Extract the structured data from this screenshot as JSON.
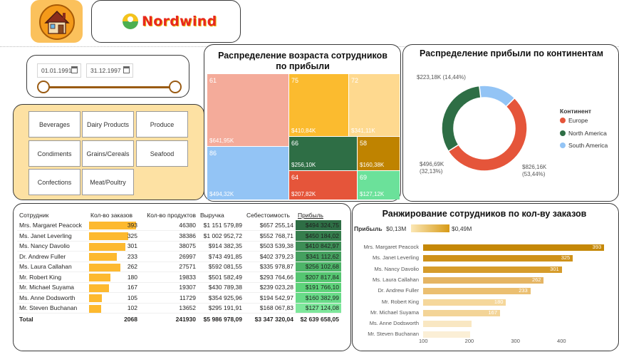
{
  "header": {
    "logo_text": "Nordwind"
  },
  "date_slicer": {
    "start": "01.01.1991",
    "end": "31.12.1997"
  },
  "categories": [
    "Beverages",
    "Dairy Products",
    "Produce",
    "Condiments",
    "Grains/Cereals",
    "Seafood",
    "Confections",
    "Meat/Poultry"
  ],
  "treemap": {
    "title": "Распределение возраста сотрудников по прибыли",
    "tiles": [
      {
        "age": "61",
        "profit": "$641,95K",
        "color": "#f4ab9a"
      },
      {
        "age": "75",
        "profit": "$410,84K",
        "color": "#fbbb2f"
      },
      {
        "age": "72",
        "profit": "$341,11K",
        "color": "#fed98f"
      },
      {
        "age": "86",
        "profit": "$494,32K",
        "color": "#93c4f5"
      },
      {
        "age": "66",
        "profit": "$256,10K",
        "color": "#2e6e45"
      },
      {
        "age": "58",
        "profit": "$160,38K",
        "color": "#bf8300"
      },
      {
        "age": "64",
        "profit": "$207,82K",
        "color": "#e5553a"
      },
      {
        "age": "69",
        "profit": "$127,12K",
        "color": "#6be19a"
      }
    ]
  },
  "donut": {
    "title": "Распределение прибыли по континентам",
    "legend_title": "Континент",
    "slices": [
      {
        "name": "Europe",
        "value_label": "$826,16K",
        "pct_label": "(53,44%)",
        "share": 0.5344,
        "color": "#e5553a"
      },
      {
        "name": "North America",
        "value_label": "$496,69K",
        "pct_label": "(32,13%)",
        "share": 0.3213,
        "color": "#2e6e45"
      },
      {
        "name": "South America",
        "value_label": "$223,18K",
        "pct_label": "(14,44%)",
        "share": 0.1444,
        "color": "#93c4f5"
      }
    ]
  },
  "table": {
    "headers": [
      "Сотрудник",
      "Кол-во заказов",
      "Кол-во продуктов",
      "Выручка",
      "Себестоимость",
      "Прибыль"
    ],
    "rows": [
      {
        "name": "Mrs. Margaret Peacock",
        "orders": 393,
        "products": "46380",
        "revenue": "$1 151 579,89",
        "cost": "$657 255,14",
        "profit": "$494 324,75",
        "green": "#2e6e45"
      },
      {
        "name": "Ms. Janet Leverling",
        "orders": 325,
        "products": "38386",
        "revenue": "$1 002 952,72",
        "cost": "$552 768,71",
        "profit": "$450 184,02",
        "green": "#357e4d"
      },
      {
        "name": "Ms. Nancy Davolio",
        "orders": 301,
        "products": "38075",
        "revenue": "$914 382,35",
        "cost": "$503 539,38",
        "profit": "$410 842,97",
        "green": "#3d8e56"
      },
      {
        "name": "Dr. Andrew Fuller",
        "orders": 233,
        "products": "26997",
        "revenue": "$743 491,85",
        "cost": "$402 379,23",
        "profit": "$341 112,62",
        "green": "#45a05f"
      },
      {
        "name": "Ms. Laura Callahan",
        "orders": 262,
        "products": "27571",
        "revenue": "$592 081,55",
        "cost": "$335 978,87",
        "profit": "$256 102,68",
        "green": "#4db468"
      },
      {
        "name": "Mr. Robert King",
        "orders": 180,
        "products": "19833",
        "revenue": "$501 582,49",
        "cost": "$293 764,66",
        "profit": "$207 817,84",
        "green": "#55c671"
      },
      {
        "name": "Mr. Michael Suyama",
        "orders": 167,
        "products": "19307",
        "revenue": "$430 789,38",
        "cost": "$239 023,28",
        "profit": "$191 766,10",
        "green": "#5dd37a"
      },
      {
        "name": "Ms. Anne Dodsworth",
        "orders": 105,
        "products": "11729",
        "revenue": "$354 925,96",
        "cost": "$194 542,97",
        "profit": "$160 382,99",
        "green": "#68db88"
      },
      {
        "name": "Mr. Steven Buchanan",
        "orders": 102,
        "products": "13652",
        "revenue": "$295 191,91",
        "cost": "$168 067,83",
        "profit": "$127 124,08",
        "green": "#7ee79b"
      }
    ],
    "total": {
      "label": "Total",
      "orders": "2068",
      "products": "241930",
      "revenue": "$5 986 978,09",
      "cost": "$3 347 320,04",
      "profit": "$2 639 658,05"
    }
  },
  "ranking": {
    "title": "Ранжирование сотрудников по кол-ву заказов",
    "legend_label": "Прибыль",
    "legend_min": "$0,13M",
    "legend_max": "$0,49M",
    "axis_ticks": [
      "100",
      "200",
      "300",
      "400"
    ],
    "chart_data": {
      "type": "bar",
      "categories": [
        "Mrs. Margaret Peacock",
        "Ms. Janet Leverling",
        "Ms. Nancy Davolio",
        "Ms. Laura Callahan",
        "Dr. Andrew Fuller",
        "Mr. Robert King",
        "Mr. Michael Suyama",
        "Ms. Anne Dodsworth",
        "Mr. Steven Buchanan"
      ],
      "values": [
        393,
        325,
        301,
        262,
        233,
        180,
        167,
        105,
        102
      ],
      "colors": [
        "#c58807",
        "#cf921a",
        "#d69c2b",
        "#e5b564",
        "#ebbf71",
        "#f5d79b",
        "#f3d497",
        "#f9e7c2",
        "#fbefd6"
      ],
      "xlim": [
        0,
        400
      ]
    }
  }
}
